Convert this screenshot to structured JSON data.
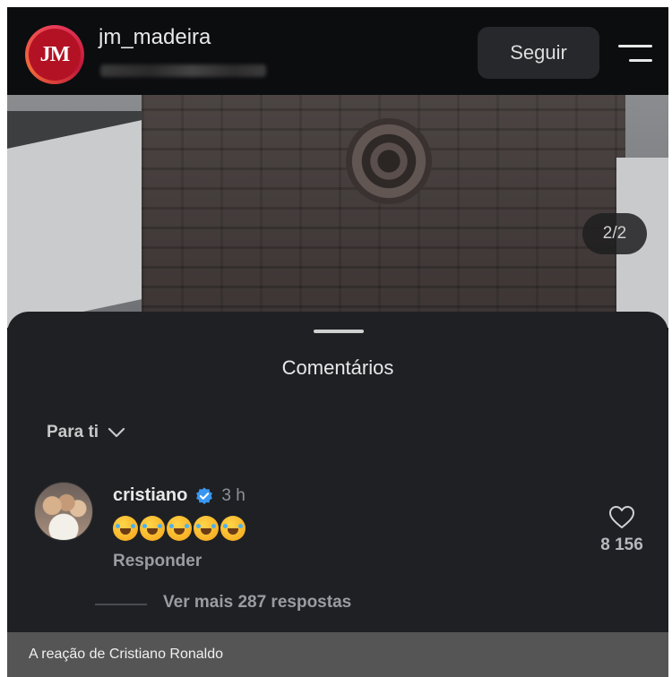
{
  "header": {
    "account_name": "jm_madeira",
    "avatar_initials": "JM",
    "follow_label": "Seguir",
    "menu_icon": "menu-icon"
  },
  "post": {
    "page_indicator": "2/2"
  },
  "comments": {
    "title": "Comentários",
    "filter_label": "Para ti",
    "filter_icon": "chevron-down-icon",
    "items": [
      {
        "username": "cristiano",
        "verified": true,
        "time": "3 h",
        "emoji": "rolling-on-floor-laughing",
        "emoji_count": 5,
        "reply_label": "Responder",
        "likes": "8 156",
        "view_replies_label": "Ver mais 287 respostas"
      }
    ]
  },
  "caption": "A reação de Cristiano Ronaldo",
  "colors": {
    "header_bg": "#0c0d0f",
    "sheet_bg": "#1e2024",
    "brand_red": "#b31224",
    "verified_blue": "#3897f0",
    "caption_bg": "#555556"
  }
}
